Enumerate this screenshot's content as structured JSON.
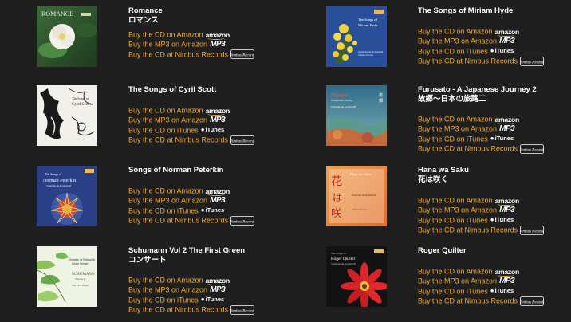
{
  "albums": [
    {
      "title": "Romance",
      "subtitle": "ロマンス",
      "links": [
        "amazon",
        "mp3",
        "nimbus"
      ],
      "cover_label": "ROMANCE"
    },
    {
      "title": "The Songs of Miriam Hyde",
      "subtitle": "",
      "links": [
        "amazon",
        "mp3",
        "itunes",
        "nimbus"
      ],
      "cover_label": "The Songs of Miriam Hyde"
    },
    {
      "title": "The Songs of Cyril Scott",
      "subtitle": "",
      "links": [
        "amazon",
        "mp3",
        "itunes",
        "nimbus"
      ],
      "cover_label": "The Songs of Cyril Scott"
    },
    {
      "title": "Furusato - A Japanese Journey 2",
      "subtitle": "故郷〜日本の旅路二",
      "links": [
        "amazon",
        "mp3",
        "itunes",
        "nimbus"
      ],
      "cover_label": "Furusato"
    },
    {
      "title": "Songs of Norman Peterkin",
      "subtitle": "",
      "links": [
        "amazon",
        "mp3",
        "itunes",
        "nimbus"
      ],
      "cover_label": "The Songs of Norman Peterkin"
    },
    {
      "title": "Hana wa Saku",
      "subtitle": "花は咲く",
      "links": [
        "amazon",
        "mp3",
        "itunes",
        "nimbus"
      ],
      "cover_label": "Hana wa Saku"
    },
    {
      "title": "Schumann Vol 2 The First Green",
      "subtitle": "コンサート",
      "links": [
        "amazon",
        "mp3",
        "itunes",
        "nimbus"
      ],
      "cover_label": "SCHUMANN"
    },
    {
      "title": "Roger Quilter",
      "subtitle": "",
      "links": [
        "amazon",
        "mp3",
        "itunes",
        "nimbus"
      ],
      "cover_label": "The Songs of Roger Quilter"
    }
  ],
  "link_labels": {
    "amazon": "Buy the CD on Amazon",
    "mp3": "Buy the MP3 on Amazon",
    "itunes": "Buy the CD on iTunes",
    "nimbus": "Buy the CD at Nimbus Records"
  },
  "brands": {
    "amazon": "amazon",
    "mp3": "MP3",
    "itunes": "iTunes",
    "nimbus": "Nimbus Records"
  },
  "colors": {
    "background": "#1f1f1f",
    "title": "#ffffff",
    "link": "#f0a830"
  },
  "icons": {
    "amazon": "amazon-logo-icon",
    "mp3": "amazon-mp3-logo-icon",
    "itunes": "apple-itunes-icon",
    "nimbus": "nimbus-records-logo-icon"
  }
}
